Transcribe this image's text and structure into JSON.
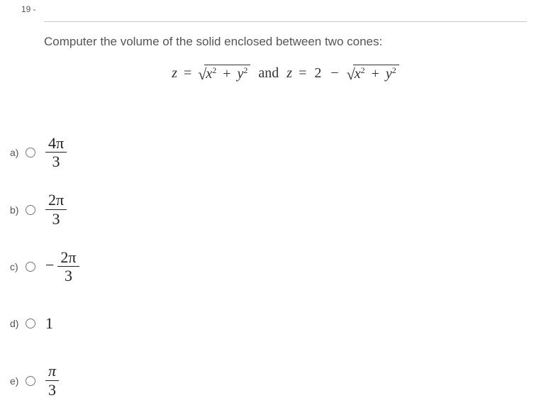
{
  "question_number": "19 -",
  "prompt": "Computer the volume of the solid enclosed between two cones:",
  "formula": {
    "z": "z",
    "eq": "=",
    "sqrt_open": "√",
    "x2": "x",
    "plus": "+",
    "y2": "y",
    "sq": "2",
    "and_text": " and ",
    "two": "2",
    "minus": "−"
  },
  "options": [
    {
      "key": "a)",
      "type": "frac",
      "neg": false,
      "top": "4π",
      "bot": "3"
    },
    {
      "key": "b)",
      "type": "frac",
      "neg": false,
      "top": "2π",
      "bot": "3"
    },
    {
      "key": "c)",
      "type": "frac",
      "neg": true,
      "top": "2π",
      "bot": "3"
    },
    {
      "key": "d)",
      "type": "plain",
      "value": "1"
    },
    {
      "key": "e)",
      "type": "frac",
      "neg": false,
      "top": "π",
      "bot": "3"
    }
  ]
}
